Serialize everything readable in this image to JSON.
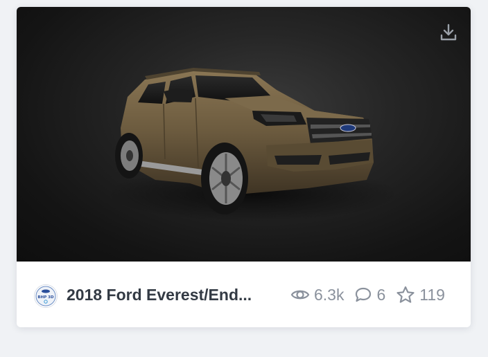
{
  "model": {
    "title": "2018 Ford Everest/End...",
    "views": "6.3k",
    "comments": "6",
    "likes": "119"
  },
  "author": {
    "avatar_text": "BHP 3D"
  },
  "icons": {
    "download": "download-icon",
    "views": "eye-icon",
    "comments": "comment-icon",
    "likes": "star-icon"
  },
  "colors": {
    "page_background": "#f0f2f5",
    "preview_background": "#1b1b1b",
    "title_text": "#333a44",
    "stat_text": "#8a919c",
    "car_body": "#6b5a3e"
  }
}
